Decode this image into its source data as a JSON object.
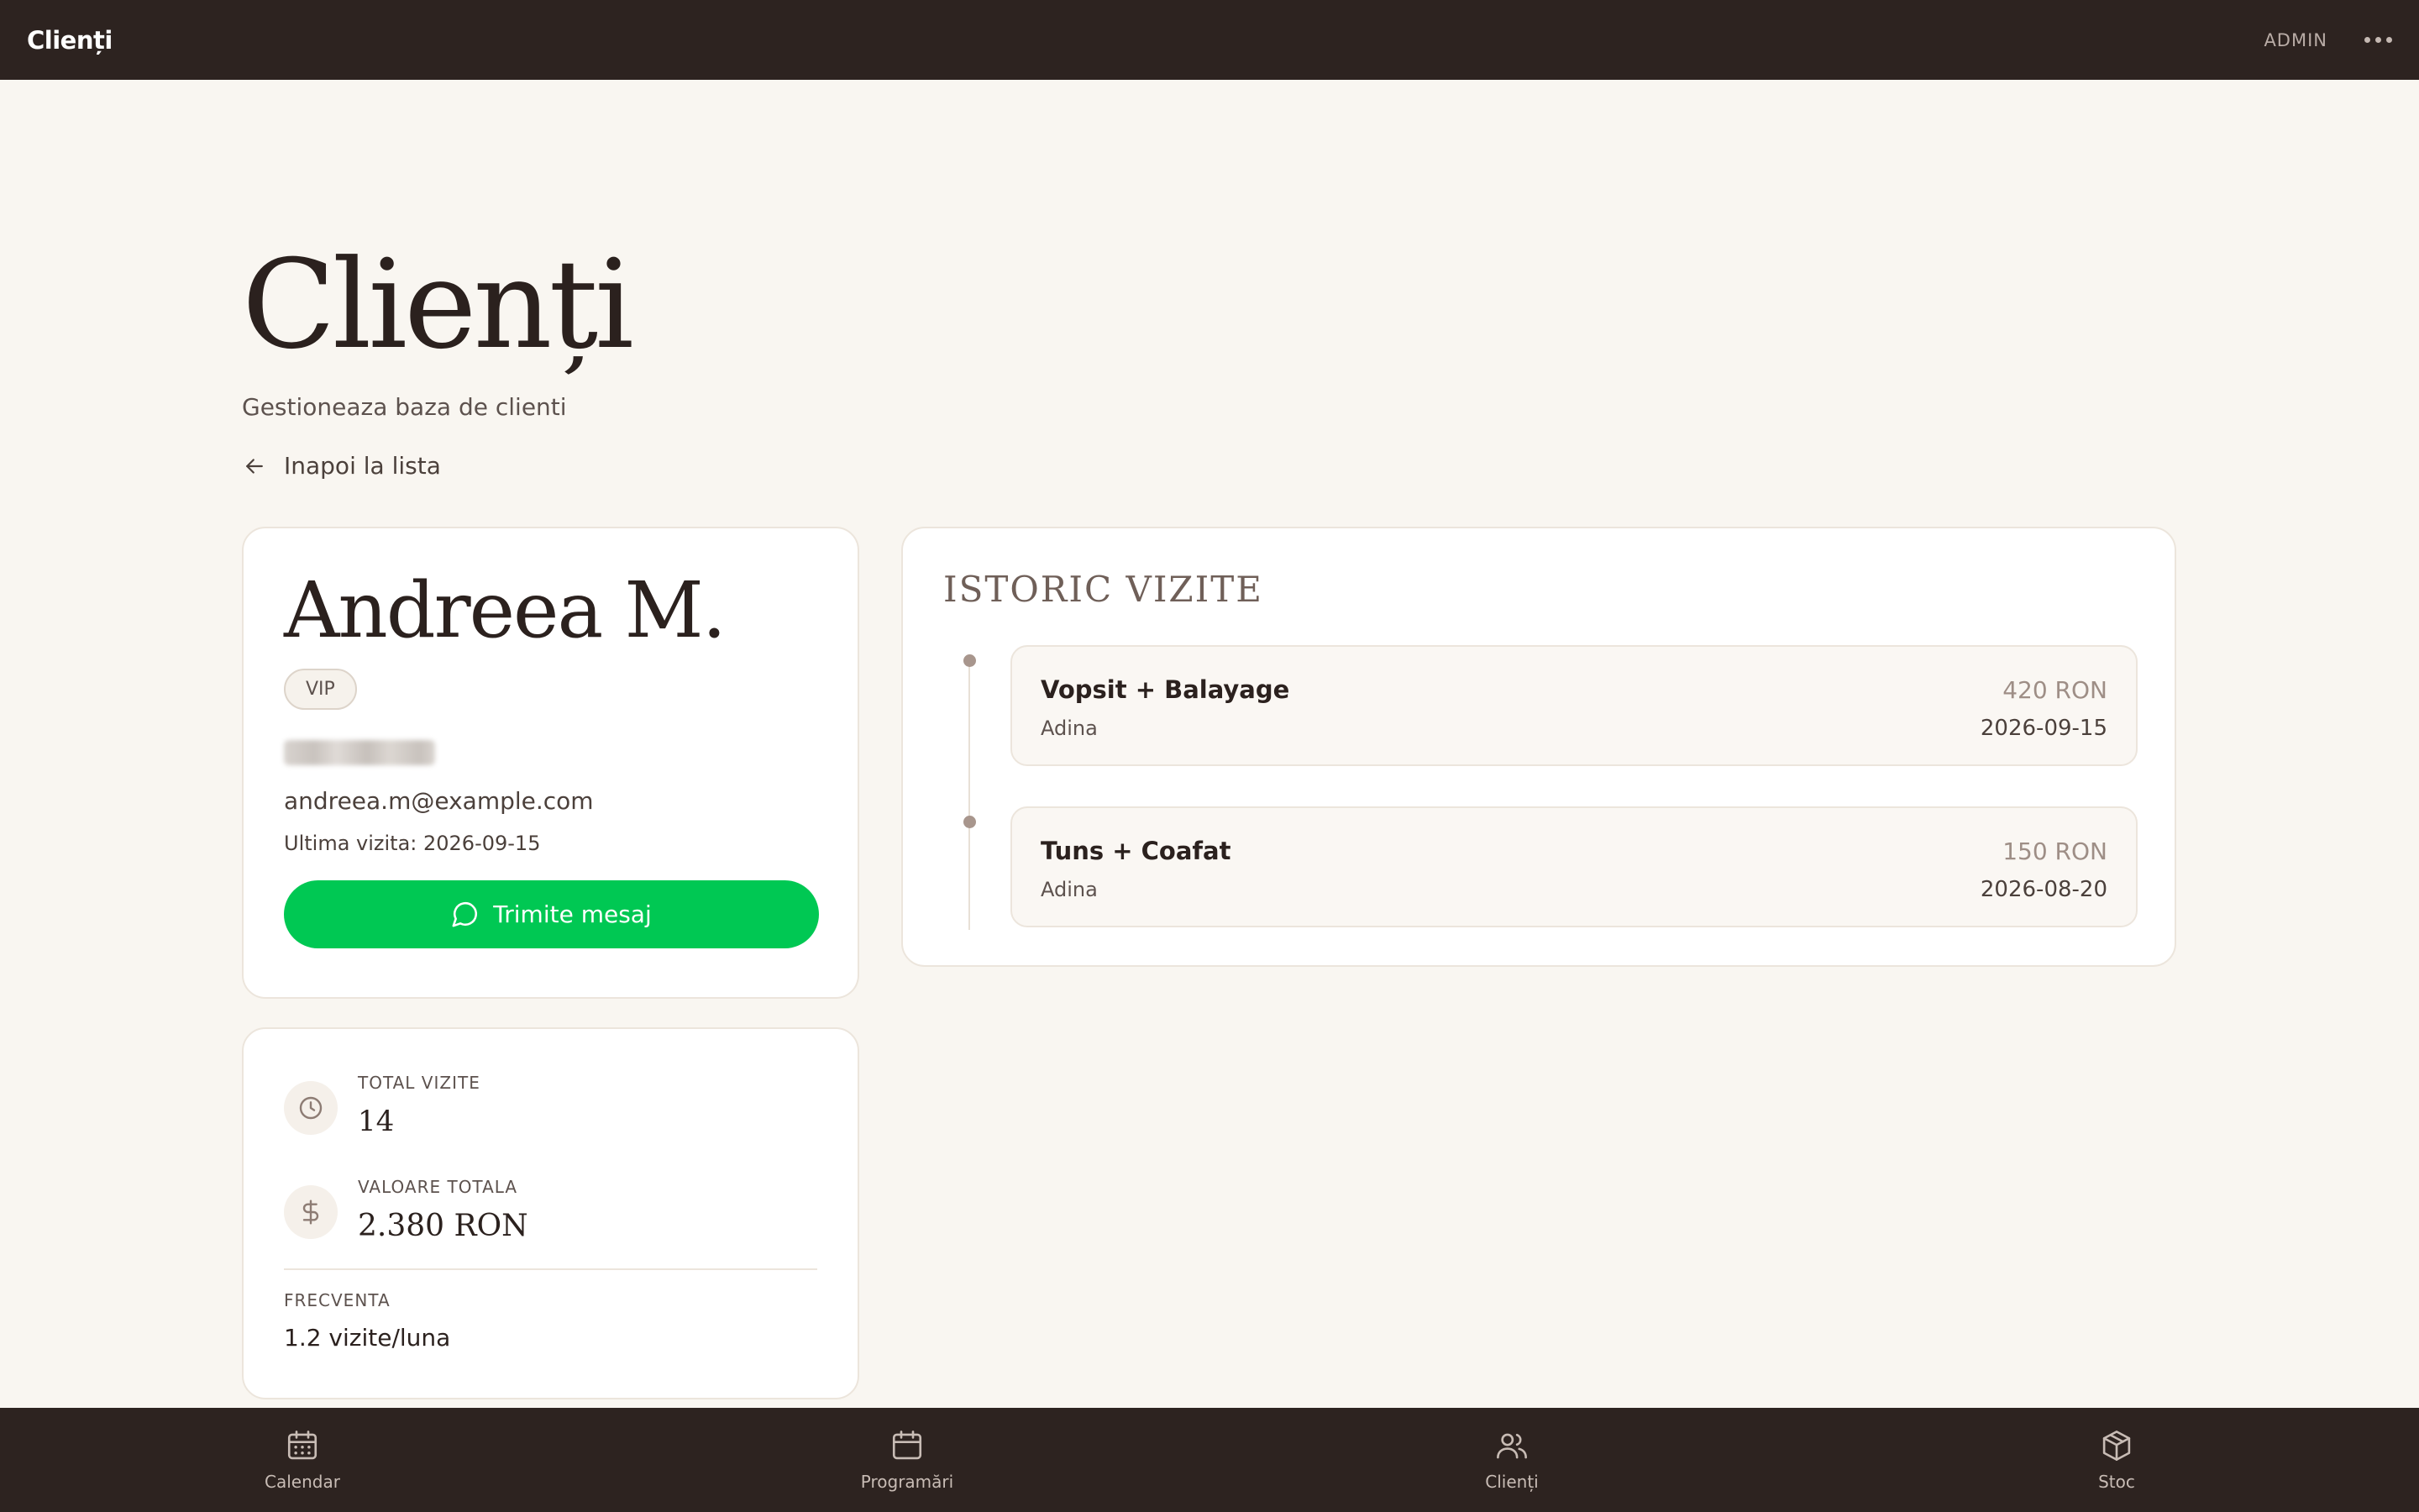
{
  "topbar": {
    "title": "Clienți",
    "admin_label": "ADMIN",
    "menu_icon": "more-dots-icon"
  },
  "page": {
    "heading": "Clienți",
    "subtitle": "Gestioneaza baza de clienti",
    "back_label": "Inapoi la lista"
  },
  "client": {
    "name": "Andreea M.",
    "badge": "VIP",
    "email": "andreea.m@example.com",
    "last_visit": "Ultima vizita: 2026-09-15",
    "message_button": "Trimite mesaj"
  },
  "stats": {
    "total_visits_label": "TOTAL VIZITE",
    "total_visits_value": "14",
    "total_value_label": "VALOARE TOTALA",
    "total_value_value": "2.380 RON",
    "frequency_label": "FRECVENTA",
    "frequency_value": "1.2 vizite/luna"
  },
  "history": {
    "title": "ISTORIC VIZITE",
    "visits": [
      {
        "service": "Vopsit + Balayage",
        "stylist": "Adina",
        "price": "420 RON",
        "date": "2026-09-15"
      },
      {
        "service": "Tuns + Coafat",
        "stylist": "Adina",
        "price": "150 RON",
        "date": "2026-08-20"
      }
    ]
  },
  "nav": [
    {
      "label": "Calendar",
      "icon": "calendar-grid-icon"
    },
    {
      "label": "Programări",
      "icon": "calendar-icon"
    },
    {
      "label": "Clienți",
      "icon": "users-icon"
    },
    {
      "label": "Stoc",
      "icon": "box-icon"
    }
  ],
  "colors": {
    "accent_green": "#00c853",
    "bar_dark": "#2d2320",
    "background": "#f9f6f1"
  }
}
